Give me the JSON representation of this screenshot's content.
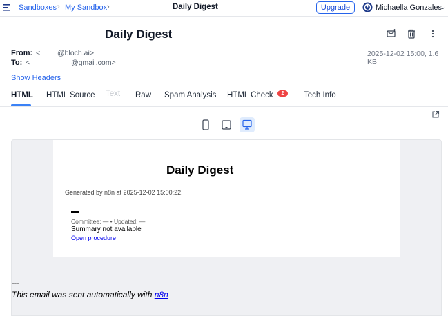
{
  "topbar": {
    "breadcrumb": [
      "Sandboxes",
      "My Sandbox"
    ],
    "title": "Daily Digest",
    "upgrade_label": "Upgrade",
    "user_name": "Michaella Gonzales"
  },
  "message": {
    "subject": "Daily Digest",
    "from_label": "From:",
    "from_open": "<",
    "from_domain": "@bloch.ai>",
    "to_label": "To:",
    "to_open": "<",
    "to_domain": "@gmail.com>",
    "meta": "2025-12-02 15:00, 1.6 KB",
    "show_headers": "Show Headers"
  },
  "tabs": [
    {
      "label": "HTML"
    },
    {
      "label": "HTML Source"
    },
    {
      "label": "Text"
    },
    {
      "label": "Raw"
    },
    {
      "label": "Spam Analysis"
    },
    {
      "label": "HTML Check"
    },
    {
      "label": "Tech Info"
    }
  ],
  "html_check_badge": "2",
  "email": {
    "title": "Daily Digest",
    "generated": "Generated by n8n at 2025-12-02 15:00:22.",
    "committee": "Committee: — • Updated: —",
    "summary": "Summary not available",
    "link": "Open procedure",
    "separator": "---",
    "footer_prefix": "This email was sent automatically with ",
    "footer_link": "n8n"
  },
  "colors": {
    "accent": "#2563eb",
    "badge": "#ef4444",
    "preview_bg": "#eff0f3"
  }
}
